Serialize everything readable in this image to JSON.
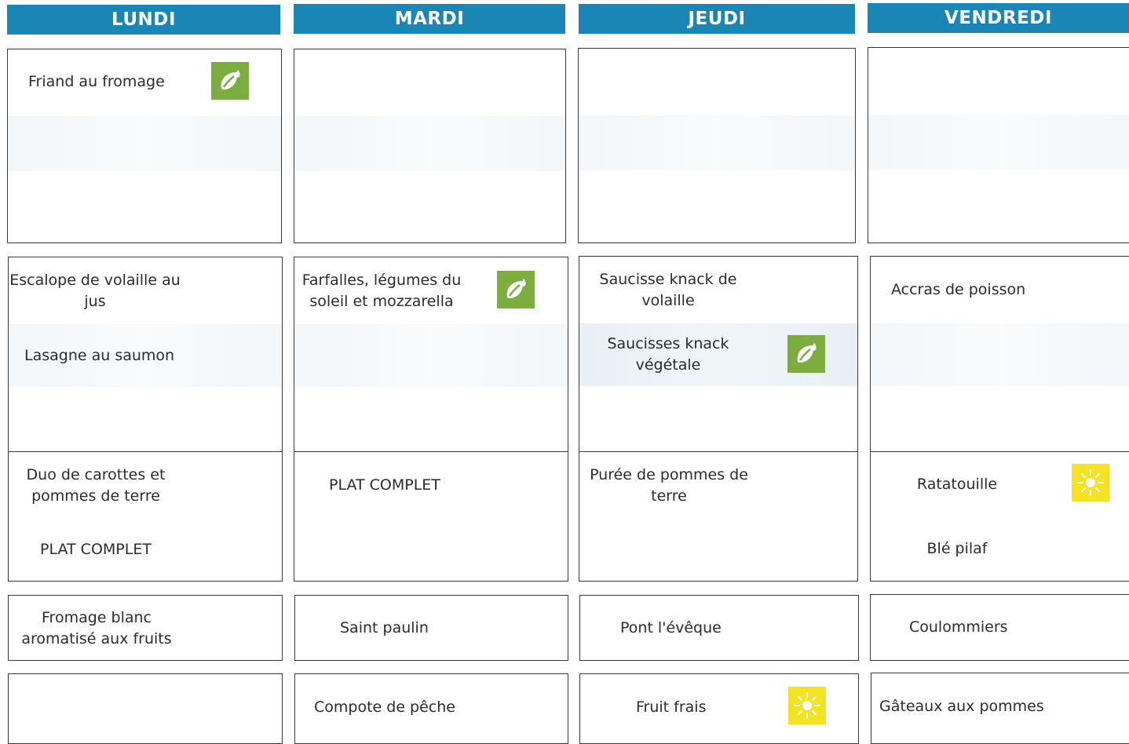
{
  "days": [
    "LUNDI",
    "MARDI",
    "JEUDI",
    "VENDREDI"
  ],
  "row1": {
    "lundi": "Friand au fromage"
  },
  "row2": {
    "lundi_line1": "Escalope de volaille au",
    "lundi_line2": "jus",
    "lundi_alt": "Lasagne au saumon",
    "mardi_line1": "Farfalles, légumes du",
    "mardi_line2": "soleil et mozzarella",
    "jeudi_line1": "Saucisse knack de",
    "jeudi_line2": "volaille",
    "jeudi_alt_line1": "Saucisses knack",
    "jeudi_alt_line2": "végétale",
    "vendredi": "Accras de poisson"
  },
  "row3": {
    "lundi_line1": "Duo de carottes et",
    "lundi_line2": "pommes de terre",
    "lundi_alt": "PLAT COMPLET",
    "mardi": "PLAT COMPLET",
    "jeudi_line1": "Purée de pommes de",
    "jeudi_line2": "terre",
    "vendredi": "Ratatouille",
    "vendredi_alt": "Blé pilaf"
  },
  "row4": {
    "lundi_line1": "Fromage blanc",
    "lundi_line2": "aromatisé aux fruits",
    "mardi": "Saint paulin",
    "jeudi": "Pont l'évêque",
    "vendredi": "Coulommiers"
  },
  "row5": {
    "mardi": "Compote de pêche",
    "jeudi": "Fruit frais",
    "vendredi": "Gâteaux aux pommes"
  },
  "icons": {
    "vegetarian": "leaf-icon",
    "seasonal": "sun-icon"
  },
  "colors": {
    "header": "#1a86b5",
    "leaf_badge": "#7cae3f",
    "sun_badge": "#f5e323"
  }
}
